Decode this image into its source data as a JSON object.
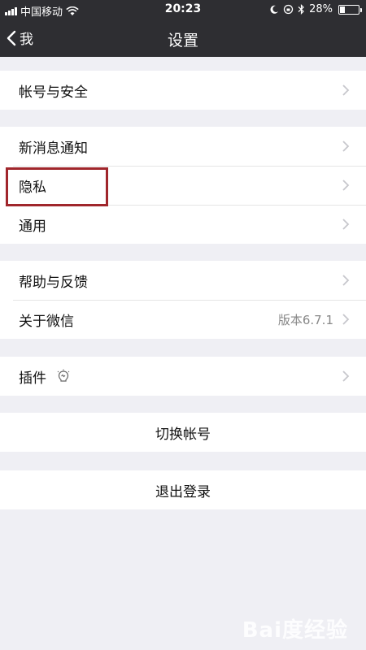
{
  "status_bar": {
    "carrier": "中国移动",
    "time": "20:23",
    "battery_text": "28%",
    "battery_level": 0.28
  },
  "nav": {
    "back_label": "我",
    "title": "设置"
  },
  "groups": {
    "account": {
      "items": [
        {
          "label": "帐号与安全"
        }
      ]
    },
    "notifications": {
      "items": [
        {
          "label": "新消息通知"
        },
        {
          "label": "隐私"
        },
        {
          "label": "通用"
        }
      ]
    },
    "help": {
      "items": [
        {
          "label": "帮助与反馈"
        },
        {
          "label": "关于微信",
          "value": "版本6.7.1"
        }
      ]
    },
    "plugins": {
      "items": [
        {
          "label": "插件",
          "icon": "plugin-icon"
        }
      ]
    }
  },
  "actions": {
    "switch_account": "切换帐号",
    "logout": "退出登录"
  },
  "colors": {
    "nav_background": "#2e2e32",
    "page_background": "#efeff4",
    "highlight_border": "#a0262c"
  },
  "watermark": "Bai度经验"
}
